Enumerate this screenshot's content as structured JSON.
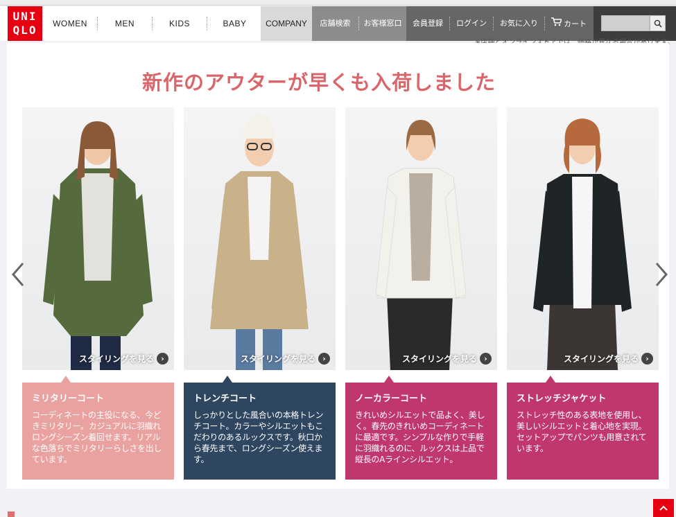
{
  "brand": {
    "logo_line1": "UNI",
    "logo_line2": "QLO"
  },
  "nav": {
    "main": [
      "WOMEN",
      "MEN",
      "KIDS",
      "BABY"
    ],
    "company": "COMPANY",
    "stores": [
      "店舗検索",
      "お客様窓口"
    ],
    "member": [
      "会員登録",
      "ログイン",
      "お気に入り"
    ],
    "cart": "カート"
  },
  "search": {
    "placeholder": ""
  },
  "notice": "※店舗とオンラインストアでは、価格が異なる場合があります。",
  "headline": "新作のアウターが早くも入荷しました",
  "styling_label": "スタイリングを見る",
  "cards": [
    {
      "title": "ミリタリーコート",
      "text": "コーディネートの主役になる、今どきミリタリー。カジュアルに羽織れロングシーズン着回せます。リアルな色落ちでミリタリーらしさを出しています。",
      "color": "#e9a2a0",
      "coat": "#556b3e"
    },
    {
      "title": "トレンチコート",
      "text": "しっかりとした風合いの本格トレンチコート。カラーやシルエットもこだわりのあるルックスです。秋口から春先まで、ロングシーズン使えます。",
      "color": "#2f4660",
      "coat": "#c9b28a"
    },
    {
      "title": "ノーカラーコート",
      "text": "きれいめシルエットで品よく、美しく。春先のきれいめコーディネートに最適です。シンプルな作りで手軽に羽織れるのに、ルックスは上品で縦長のAラインシルエット。",
      "color": "#c0366f",
      "coat": "#f3f1ec"
    },
    {
      "title": "ストレッチジャケット",
      "text": "ストレッチ性のある表地を使用し、美しいシルエットと着心地を実現。セットアップでパンツも用意されています。",
      "color": "#c0366f",
      "coat": "#1f2427"
    }
  ],
  "colors": {
    "brand_red": "#e60012",
    "headline": "#d9666a"
  }
}
